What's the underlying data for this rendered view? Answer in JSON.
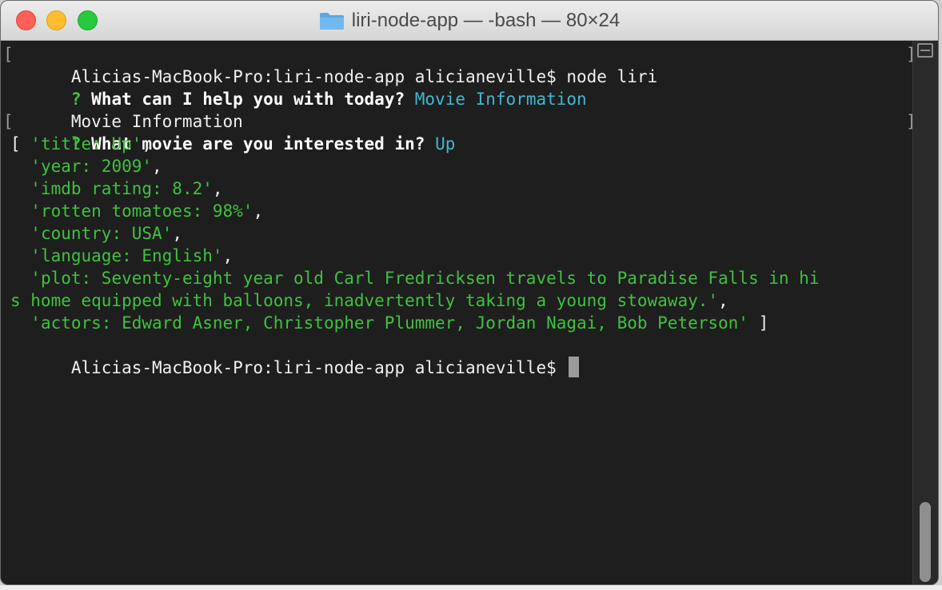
{
  "window": {
    "title": "liri-node-app — -bash — 80×24",
    "folder_icon": "folder-icon",
    "controls": [
      "close-icon",
      "minimize-icon",
      "zoom-icon"
    ]
  },
  "colors": {
    "background": "#1e1e1e",
    "text": "#f0f0f0",
    "prompt_marker": "#3ec63e",
    "answer": "#3fb8d2",
    "string_output": "#3fc13f",
    "cursor": "#9b9b9b"
  },
  "terminal": {
    "line1": {
      "prompt": "Alicias-MacBook-Pro:liri-node-app alicianeville$ ",
      "command": "node liri"
    },
    "line2": {
      "marker": "?",
      "question": "What can I help you with today?",
      "answer": "Movie Information"
    },
    "line3": {
      "text": "Movie Information"
    },
    "line4": {
      "marker": "?",
      "question": "What movie are you interested in?",
      "answer": "Up"
    },
    "output": {
      "open": "[ ",
      "items": [
        {
          "value": "'title: Up'",
          "sep": ","
        },
        {
          "value": "'year: 2009'",
          "sep": ","
        },
        {
          "value": "'imdb rating: 8.2'",
          "sep": ","
        },
        {
          "value": "'rotten tomatoes: 98%'",
          "sep": ","
        },
        {
          "value": "'country: USA'",
          "sep": ","
        },
        {
          "value": "'language: English'",
          "sep": ","
        },
        {
          "value_line1": "'plot: Seventy-eight year old Carl Fredricksen travels to Paradise Falls in hi",
          "value_line2": "s home equipped with balloons, inadvertently taking a young stowaway.'",
          "sep": ","
        },
        {
          "value": "'actors: Edward Asner, Christopher Plummer, Jordan Nagai, Bob Peterson'",
          "sep": " ]"
        }
      ]
    },
    "final_prompt": "Alicias-MacBook-Pro:liri-node-app alicianeville$ ",
    "bracket_left": "[",
    "bracket_right": "]"
  },
  "scrollbar": {
    "split_icon": "split-pane-icon"
  }
}
